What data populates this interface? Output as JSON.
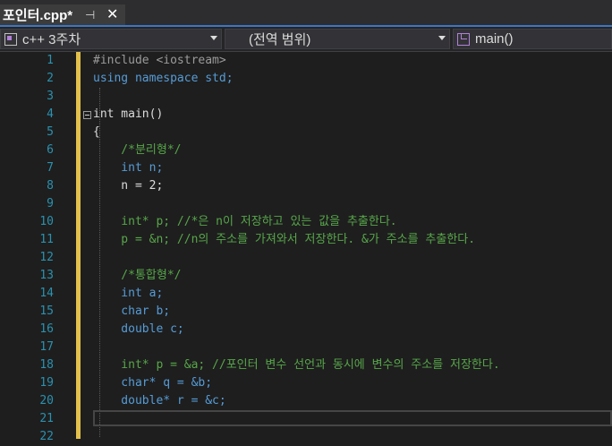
{
  "tab": {
    "title": "포인터.cpp*",
    "pin_icon": "pin-icon",
    "close_icon": "close-icon"
  },
  "nav": {
    "project": "c++ 3주차",
    "scope": "(전역 범위)",
    "member": "main()"
  },
  "editor": {
    "line_numbers": [
      "1",
      "2",
      "3",
      "4",
      "5",
      "6",
      "7",
      "8",
      "9",
      "10",
      "11",
      "12",
      "13",
      "14",
      "15",
      "16",
      "17",
      "18",
      "19",
      "20",
      "21",
      "22"
    ],
    "lines": [
      "#include <iostream>",
      "using namespace std;",
      "",
      "int main()",
      "{",
      "    /*분리형*/",
      "    int n;",
      "    n = 2;",
      "",
      "    int* p; //*은 n이 저장하고 있는 값을 추출한다.",
      "    p = &n; //n의 주소를 가져와서 저장한다. &가 주소를 추출한다.",
      "",
      "    /*통합형*/",
      "    int a;",
      "    char b;",
      "    double c;",
      "",
      "    int* p = &a; //포인터 변수 선언과 동시에 변수의 주소를 저장한다.",
      "    char* q = &b;",
      "    double* r = &c;",
      "",
      ""
    ]
  },
  "colors": {
    "keyword": "#569cd6",
    "comment": "#57a64a",
    "line_number": "#2b91af",
    "change_bar": "#e2c04c",
    "tab_accent": "#3b76c4"
  }
}
